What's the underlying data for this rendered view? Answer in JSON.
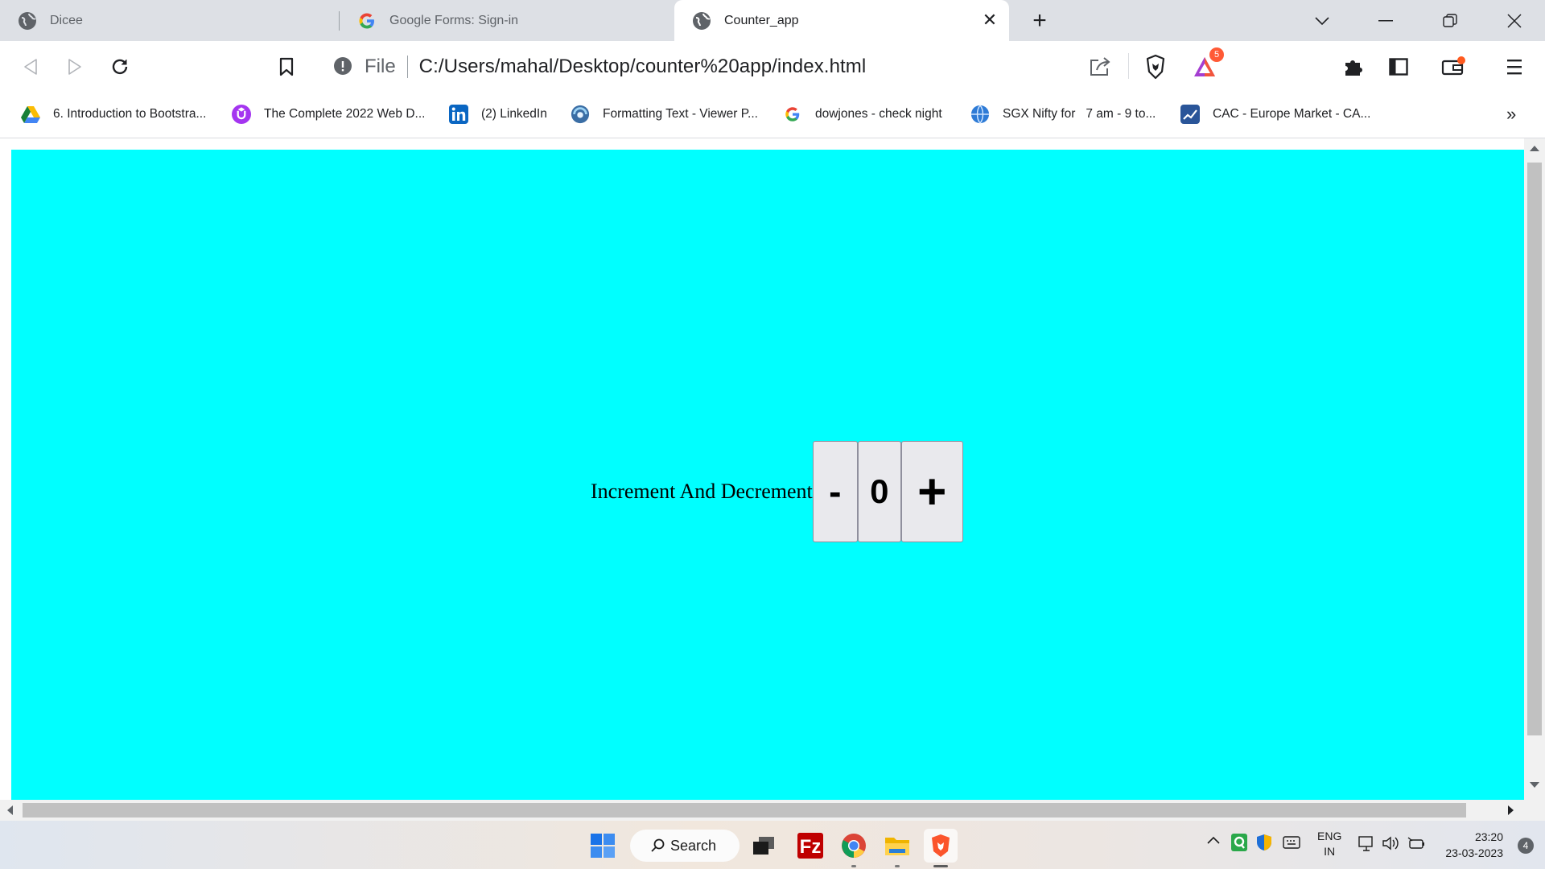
{
  "browser": {
    "tabs": [
      {
        "title": "Dicee",
        "icon": "globe-icon",
        "active": false
      },
      {
        "title": "Google Forms: Sign-in",
        "icon": "google-icon",
        "active": false
      },
      {
        "title": "Counter_app",
        "icon": "globe-icon",
        "active": true
      }
    ],
    "address": {
      "scheme": "File",
      "url": "C:/Users/mahal/Desktop/counter%20app/index.html"
    },
    "brave_badge": "5",
    "bookmarks": [
      {
        "label": "6. Introduction to Bootstra...",
        "icon": "google-drive-icon"
      },
      {
        "label": "The Complete 2022 Web D...",
        "icon": "udemy-icon"
      },
      {
        "label": "(2) LinkedIn",
        "icon": "linkedin-icon"
      },
      {
        "label": "Formatting Text - Viewer P...",
        "icon": "app-icon"
      },
      {
        "label": "dowjones - check night",
        "icon": "google-icon"
      },
      {
        "label": "SGX Nifty for   7 am - 9 to...",
        "icon": "globe-blue-icon"
      },
      {
        "label": "CAC - Europe Market - CA...",
        "icon": "chart-icon"
      }
    ],
    "more_bookmarks": "»"
  },
  "page": {
    "background": "#00ffff",
    "counter": {
      "label": "Increment And Decrement",
      "decrement": "-",
      "value": "0",
      "increment": "+"
    }
  },
  "taskbar": {
    "search_label": "Search",
    "lang_top": "ENG",
    "lang_bottom": "IN",
    "time": "23:20",
    "date": "23-03-2023",
    "notification_count": "4"
  }
}
